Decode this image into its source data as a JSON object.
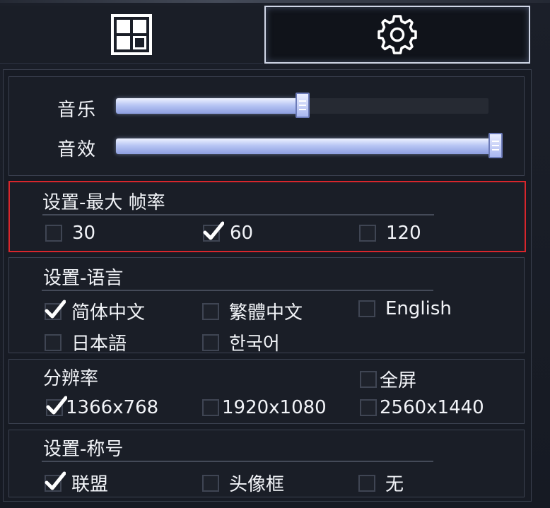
{
  "colors": {
    "accent_fill": "#b8c6f4",
    "highlight_border": "#d8262c",
    "text": "#f2f4f8"
  },
  "tabs": {
    "layout_icon": "grid-layout-icon",
    "settings_icon": "gear-icon",
    "active": "settings"
  },
  "audio": {
    "music": {
      "label": "音乐",
      "level": 0.5
    },
    "sfx": {
      "label": "音效",
      "level": 1.0
    }
  },
  "framerate": {
    "title": "设置-最大 帧率",
    "options": [
      {
        "label": "30",
        "checked": false
      },
      {
        "label": "60",
        "checked": true
      },
      {
        "label": "120",
        "checked": false
      }
    ]
  },
  "language": {
    "title": "设置-语言",
    "options": [
      {
        "label": "简体中文",
        "checked": true
      },
      {
        "label": "繁體中文",
        "checked": false
      },
      {
        "label": "English",
        "checked": false
      },
      {
        "label": "日本語",
        "checked": false
      },
      {
        "label": "한국어",
        "checked": false
      }
    ]
  },
  "resolution": {
    "title": "分辨率",
    "fullscreen": {
      "label": "全屏",
      "checked": false
    },
    "options": [
      {
        "label": "1366x768",
        "checked": true
      },
      {
        "label": "1920x1080",
        "checked": false
      },
      {
        "label": "2560x1440",
        "checked": false
      }
    ]
  },
  "title_setting": {
    "title": "设置-称号",
    "options": [
      {
        "label": "联盟",
        "checked": true
      },
      {
        "label": "头像框",
        "checked": false
      },
      {
        "label": "无",
        "checked": false
      }
    ]
  }
}
